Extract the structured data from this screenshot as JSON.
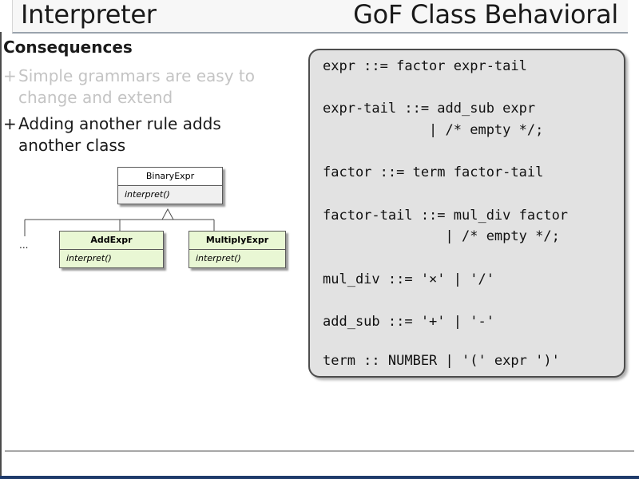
{
  "header": {
    "title": "Interpreter",
    "category": "GoF Class Behavioral"
  },
  "consequences": {
    "heading": "Consequences",
    "bullets": [
      {
        "marker": "+",
        "line1": "Simple grammars are easy to",
        "line2": "change and extend"
      },
      {
        "marker": "+",
        "line1": "Adding another rule adds",
        "line2": "another class"
      }
    ]
  },
  "uml": {
    "parent": {
      "name": "BinaryExpr",
      "method": "interpret()"
    },
    "children": [
      {
        "name": "AddExpr",
        "method": "interpret()"
      },
      {
        "name": "MultiplyExpr",
        "method": "interpret()"
      }
    ],
    "more": "..."
  },
  "grammar": {
    "lines": [
      "expr ::= factor expr-tail",
      "expr-tail ::= add_sub expr",
      "             | /* empty */;",
      "factor ::= term factor-tail",
      "factor-tail ::= mul_div factor",
      "               | /* empty */;",
      "mul_div ::= '×' | '/'",
      "add_sub ::= '+' | '-'",
      "term :: NUMBER | '(' expr ')'"
    ]
  },
  "colors": {
    "class_fill": "#e9f7d4",
    "panel_fill": "#e2e2e2",
    "faded_text": "#c4c4c4"
  }
}
